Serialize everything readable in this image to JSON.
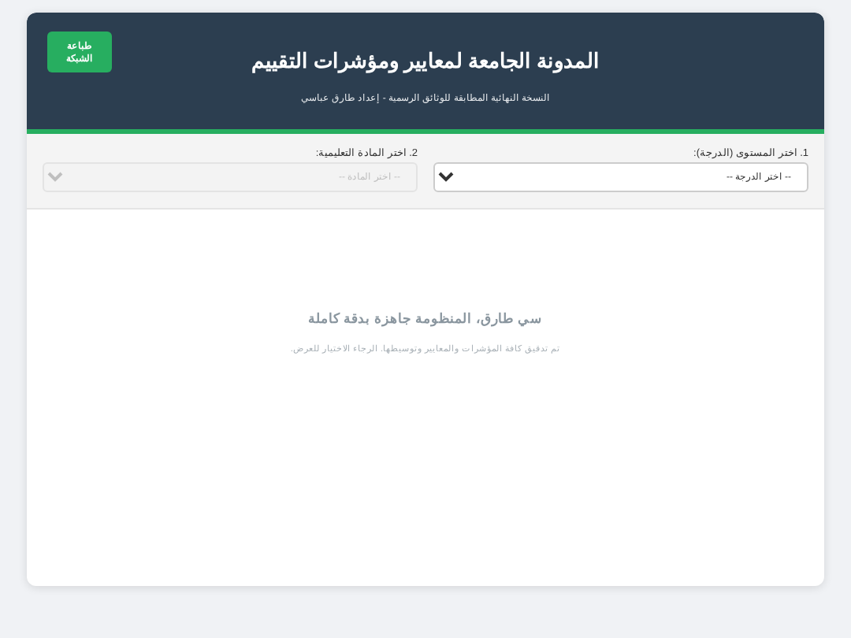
{
  "header": {
    "title": "المدونة الجامعة لمعايير ومؤشرات التقييم",
    "subtitle": "النسخة النهائية المطابقة للوثائق الرسمية - إعداد طارق عباسي",
    "print_button": "طباعة الشبكة"
  },
  "filters": [
    {
      "label": "1. اختر المستوى (الدرجة):",
      "value": "-- اختر الدرجة --",
      "disabled": false
    },
    {
      "label": "2. اختر المادة التعليمية:",
      "value": "-- اختر المادة --",
      "disabled": true
    }
  ],
  "message": {
    "title": "سي طارق، المنظومة جاهزة بدقة كاملة",
    "text": "تم تدقيق كافة المؤشرات والمعايير وتوسيطها. الرجاء الاختيار للعرض."
  }
}
